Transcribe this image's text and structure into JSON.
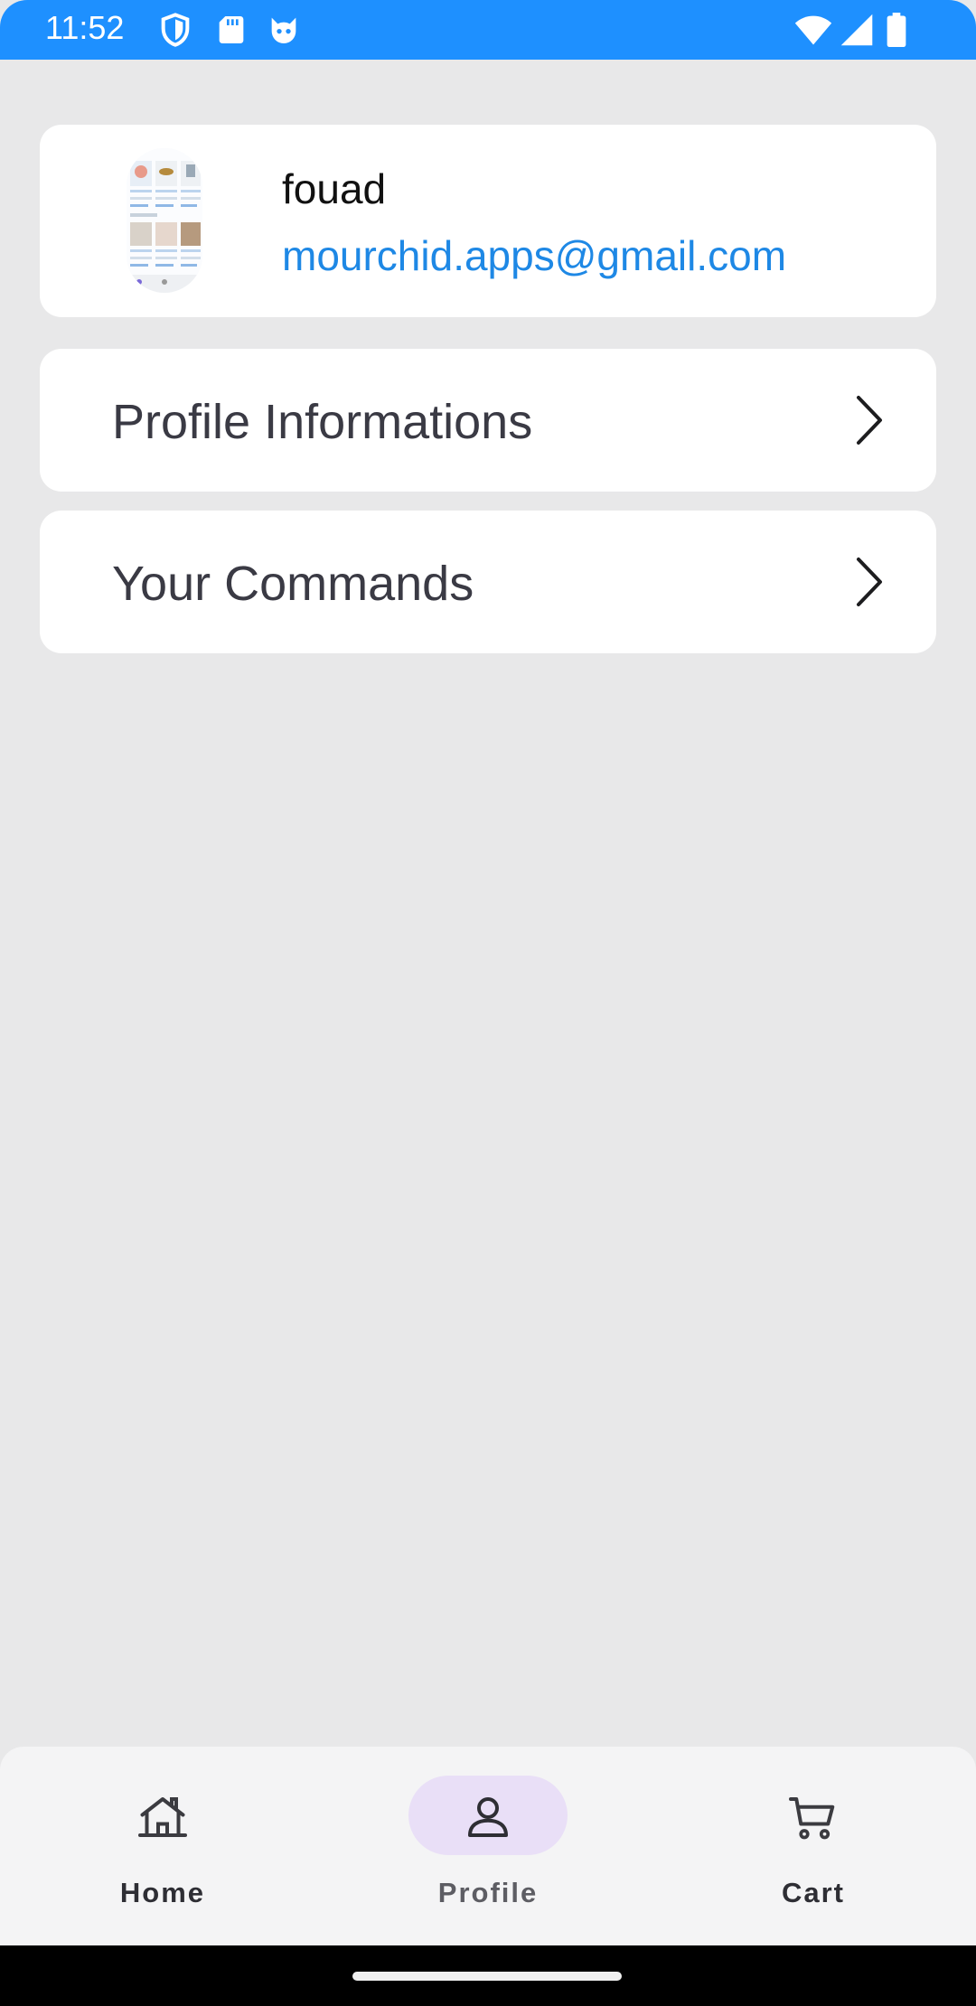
{
  "status_bar": {
    "time": "11:52",
    "left_icons": [
      "shield-icon",
      "sd-card-icon",
      "cat-face-icon"
    ],
    "right_icons": [
      "wifi-icon",
      "cellular-signal-icon",
      "battery-icon"
    ],
    "background_color": "#1e90ff"
  },
  "profile": {
    "name": "fouad",
    "email": "mourchid.apps@gmail.com",
    "email_color": "#1e88e5"
  },
  "menu": {
    "items": [
      {
        "label": "Profile Informations",
        "icon": "chevron-right-icon"
      },
      {
        "label": "Your Commands",
        "icon": "chevron-right-icon"
      }
    ]
  },
  "bottom_nav": {
    "items": [
      {
        "label": "Home",
        "icon": "home-icon",
        "selected": false
      },
      {
        "label": "Profile",
        "icon": "person-icon",
        "selected": true
      },
      {
        "label": "Cart",
        "icon": "cart-icon",
        "selected": false
      }
    ],
    "selected_pill_color": "#e9dff7"
  }
}
